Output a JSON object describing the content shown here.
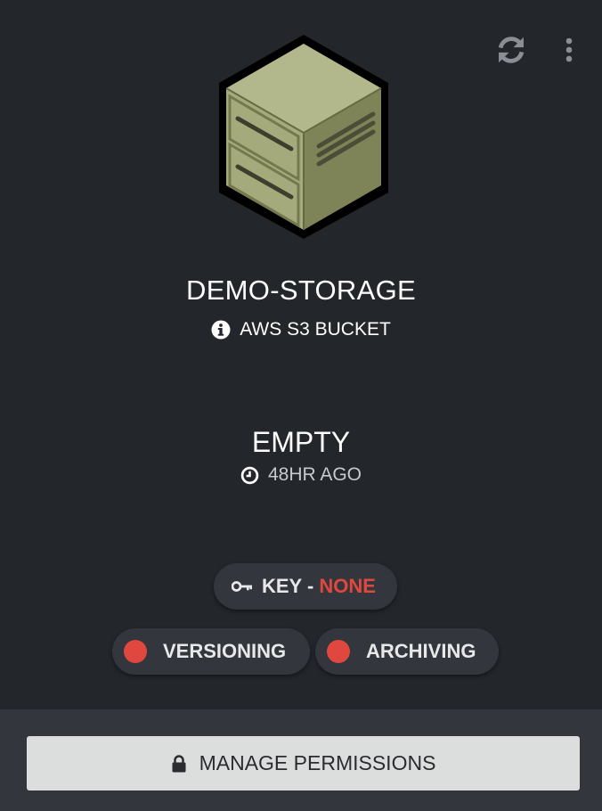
{
  "bucket": {
    "name": "DEMO-STORAGE",
    "type": "AWS S3 BUCKET",
    "icon": "storage-cabinet-icon"
  },
  "status": {
    "value": "EMPTY",
    "time": "48HR AGO"
  },
  "key": {
    "label": "KEY",
    "separator": " - ",
    "value": "NONE"
  },
  "features": {
    "versioning": {
      "label": "VERSIONING",
      "enabled": false
    },
    "archiving": {
      "label": "ARCHIVING",
      "enabled": false
    }
  },
  "footer": {
    "manage_label": "MANAGE PERMISSIONS"
  },
  "colors": {
    "background": "#23262b",
    "footer_bg": "#33373d",
    "pill_bg": "#33363c",
    "alert_red": "#e0483f",
    "button_bg": "#dcdddd",
    "cabinet_olive": "#a3a87a"
  }
}
